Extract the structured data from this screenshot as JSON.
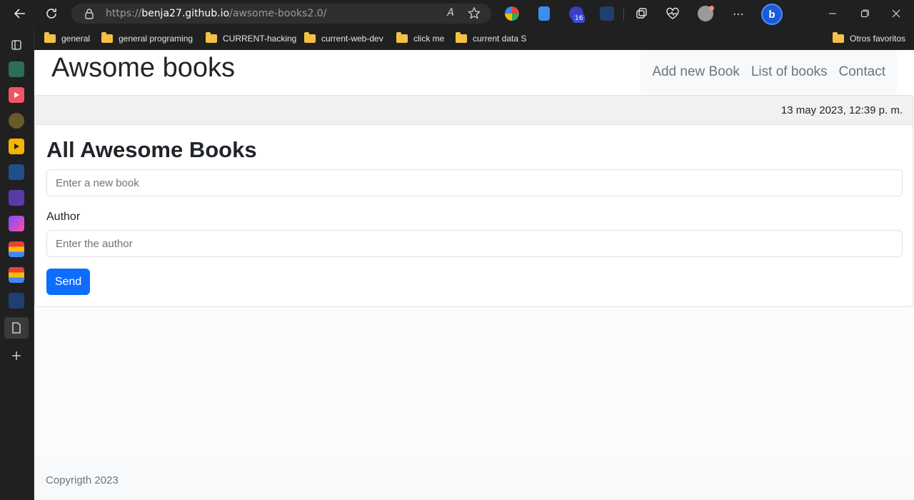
{
  "browser": {
    "url_scheme": "https://",
    "url_host": "benja27.github.io",
    "url_path": "/awsome-books2.0/",
    "read_aloud_label": "A",
    "extension_badge": "16",
    "bing_label": "b",
    "bookmarks": [
      {
        "label": "general"
      },
      {
        "label": "general programing"
      },
      {
        "label": "CURRENT-hacking"
      },
      {
        "label": "current-web-dev"
      },
      {
        "label": "click me"
      },
      {
        "label": "current data S"
      }
    ],
    "other_favorites": "Otros favoritos"
  },
  "site": {
    "logo": "Awsome books",
    "nav": {
      "add": "Add new Book",
      "list": "List of books",
      "contact": "Contact"
    },
    "date": "13 may 2023, 12:39 p. m.",
    "section_title": "All Awesome Books",
    "form": {
      "book_placeholder": "Enter a new book",
      "author_label": "Author",
      "author_placeholder": "Enter the author",
      "send_label": "Send"
    },
    "footer": "Copyrigth 2023"
  },
  "colors": {
    "primary_button": "#0d6efd",
    "chrome_bg": "#202020",
    "folder": "#f4c145"
  }
}
